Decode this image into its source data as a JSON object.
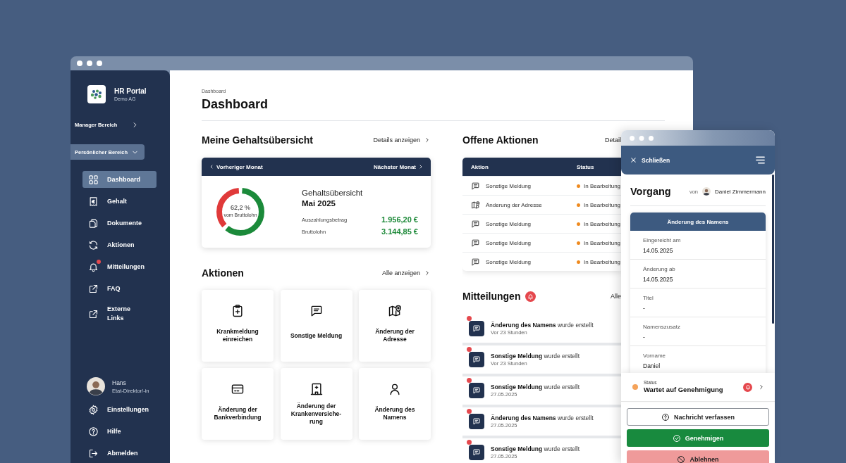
{
  "sidebar": {
    "brand": {
      "name": "HR Portal",
      "subtitle": "Demo AG"
    },
    "sections": [
      {
        "label": "Manager Bereich",
        "expanded": false
      },
      {
        "label": "Persönlicher Bereich",
        "expanded": true
      }
    ],
    "items": [
      {
        "label": "Dashboard",
        "kind": "grid",
        "selected": true,
        "unread": false
      },
      {
        "label": "Gehalt",
        "kind": "receipt",
        "selected": false,
        "unread": false
      },
      {
        "label": "Dokumente",
        "kind": "documents",
        "selected": false,
        "unread": false
      },
      {
        "label": "Aktionen",
        "kind": "refresh",
        "selected": false,
        "unread": false
      },
      {
        "label": "Mitteilungen",
        "kind": "bell",
        "selected": false,
        "unread": true
      },
      {
        "label": "FAQ",
        "kind": "external",
        "selected": false,
        "unread": false
      },
      {
        "label": "Externe\nLinks",
        "kind": "external",
        "selected": false,
        "unread": false
      }
    ],
    "user": {
      "name": "Hans",
      "role": "Etat-Direktor/-in"
    },
    "footer": [
      {
        "label": "Einstellungen",
        "kind": "gear"
      },
      {
        "label": "Hilfe",
        "kind": "help"
      },
      {
        "label": "Abmelden",
        "kind": "logout"
      }
    ]
  },
  "main": {
    "breadcrumb": "Dashboard",
    "title": "Dashboard",
    "salary": {
      "title": "Meine Gehaltsübersicht",
      "link": "Details anzeigen",
      "prev": "Vorheriger Monat",
      "next": "Nächster Monat",
      "level": 0.622,
      "percent": "62,2 %",
      "percent_caption": "vom Bruttolohn",
      "heading": "Gehaltsübersicht",
      "period": "Mai 2025",
      "rows": [
        {
          "label": "Auszahlungsbetrag",
          "value": "1.956,20 €"
        },
        {
          "label": "Bruttolohn",
          "value": "3.144,85 €"
        }
      ]
    },
    "actions": {
      "title": "Aktionen",
      "link": "Alle anzeigen",
      "tiles": [
        {
          "label": "Krankmeldung einreichen",
          "kind": "clipboard"
        },
        {
          "label": "Sonstige Meldung",
          "kind": "chat"
        },
        {
          "label": "Änderung der Adresse",
          "kind": "map"
        },
        {
          "label": "Änderung der Bankverbindung",
          "kind": "card"
        },
        {
          "label": "Änderung der Krankenversiche-rung",
          "kind": "building"
        },
        {
          "label": "Änderung des Namens",
          "kind": "person"
        }
      ]
    },
    "open_actions": {
      "title": "Offene Aktionen",
      "link": "Detail",
      "columns": [
        "Aktion",
        "Status"
      ],
      "rows": [
        {
          "action": "Sonstige Meldung",
          "kind": "chat",
          "status": "In Bearbeitung"
        },
        {
          "action": "Änderung der Adresse",
          "kind": "map",
          "status": "In Bearbeitung"
        },
        {
          "action": "Sonstige Meldung",
          "kind": "chat",
          "status": "In Bearbeitung"
        },
        {
          "action": "Sonstige Meldung",
          "kind": "chat",
          "status": "In Bearbeitung"
        },
        {
          "action": "Sonstige Meldung",
          "kind": "chat",
          "status": "In Bearbeitung"
        }
      ]
    },
    "notifications": {
      "title": "Mitteilungen",
      "link": "Alle",
      "items": [
        {
          "text": "**Änderung des Namens** wurde erstellt",
          "time": "Vor 23 Stunden",
          "unread": true
        },
        {
          "text": "**Sonstige Meldung** wurde erstellt",
          "time": "Vor 23 Stunden",
          "unread": true
        },
        {
          "text": "**Sonstige Meldung** wurde erstellt",
          "time": "27.05.2025",
          "unread": true
        },
        {
          "text": "**Änderung des Namens** wurde erstellt",
          "time": "27.05.2025",
          "unread": true
        },
        {
          "text": "**Sonstige Meldung** wurde erstellt",
          "time": "27.05.2025",
          "unread": true
        }
      ]
    }
  },
  "panel": {
    "close": "Schließen",
    "title": "Vorgang",
    "by": "von",
    "person": "Daniel Zimmermann",
    "card_title": "Änderung des Namens",
    "fields": [
      {
        "label": "Eingereicht am",
        "value": "14.05.2025"
      },
      {
        "label": "Änderung ab",
        "value": "14.05.2025"
      },
      {
        "label": "Titel",
        "value": "-"
      },
      {
        "label": "Namenszusatz",
        "value": "-"
      },
      {
        "label": "Vorname",
        "value": "Daniel"
      }
    ],
    "status": {
      "label": "Status",
      "value": "Wartet auf Genehmigung"
    },
    "buttons": [
      {
        "label": "Nachricht verfassen",
        "kind": "outline"
      },
      {
        "label": "Genehmigen",
        "kind": "primary"
      },
      {
        "label": "Ablehnen",
        "kind": "danger"
      }
    ]
  }
}
